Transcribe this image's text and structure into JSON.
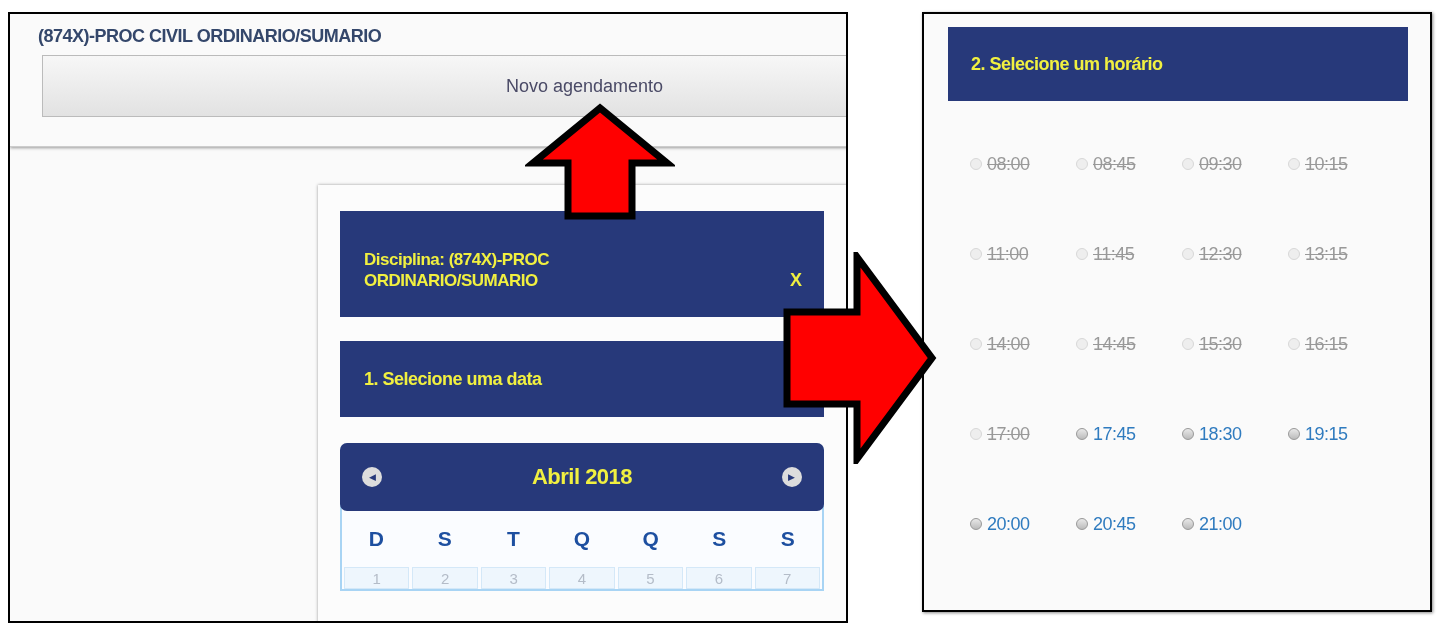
{
  "left_screen": {
    "card_title": "(874X)-PROC CIVIL ORDINARIO/SUMARIO",
    "new_button": "Novo agendamento",
    "panel": {
      "discipline_header": "Disciplina: (874X)-PROC\nORDINARIO/SUMARIO",
      "close": "X",
      "step_1": "1. Selecione uma data",
      "calendar": {
        "prev": "◀",
        "month": "Abril 2018",
        "next": "▶",
        "weekdays": [
          "D",
          "S",
          "T",
          "Q",
          "Q",
          "S",
          "S"
        ],
        "days": [
          "1",
          "2",
          "3",
          "4",
          "5",
          "6",
          "7"
        ]
      }
    }
  },
  "right_screen": {
    "step_2": "2. Selecione um horário",
    "slots": [
      {
        "time": "08:00",
        "disabled": true,
        "selected": false
      },
      {
        "time": "08:45",
        "disabled": true,
        "selected": false
      },
      {
        "time": "09:30",
        "disabled": true,
        "selected": false
      },
      {
        "time": "10:15",
        "disabled": true,
        "selected": false
      },
      {
        "time": "11:00",
        "disabled": true,
        "selected": false
      },
      {
        "time": "11:45",
        "disabled": true,
        "selected": false
      },
      {
        "time": "12:30",
        "disabled": true,
        "selected": false
      },
      {
        "time": "13:15",
        "disabled": true,
        "selected": false
      },
      {
        "time": "14:00",
        "disabled": true,
        "selected": false
      },
      {
        "time": "14:45",
        "disabled": true,
        "selected": false
      },
      {
        "time": "15:30",
        "disabled": true,
        "selected": false
      },
      {
        "time": "16:15",
        "disabled": true,
        "selected": false
      },
      {
        "time": "17:00",
        "disabled": true,
        "selected": false
      },
      {
        "time": "17:45",
        "disabled": false,
        "selected": false
      },
      {
        "time": "18:30",
        "disabled": false,
        "selected": false
      },
      {
        "time": "19:15",
        "disabled": false,
        "selected": false
      },
      {
        "time": "20:00",
        "disabled": false,
        "selected": false
      },
      {
        "time": "20:45",
        "disabled": false,
        "selected": false
      },
      {
        "time": "21:00",
        "disabled": false,
        "selected": false
      }
    ]
  }
}
